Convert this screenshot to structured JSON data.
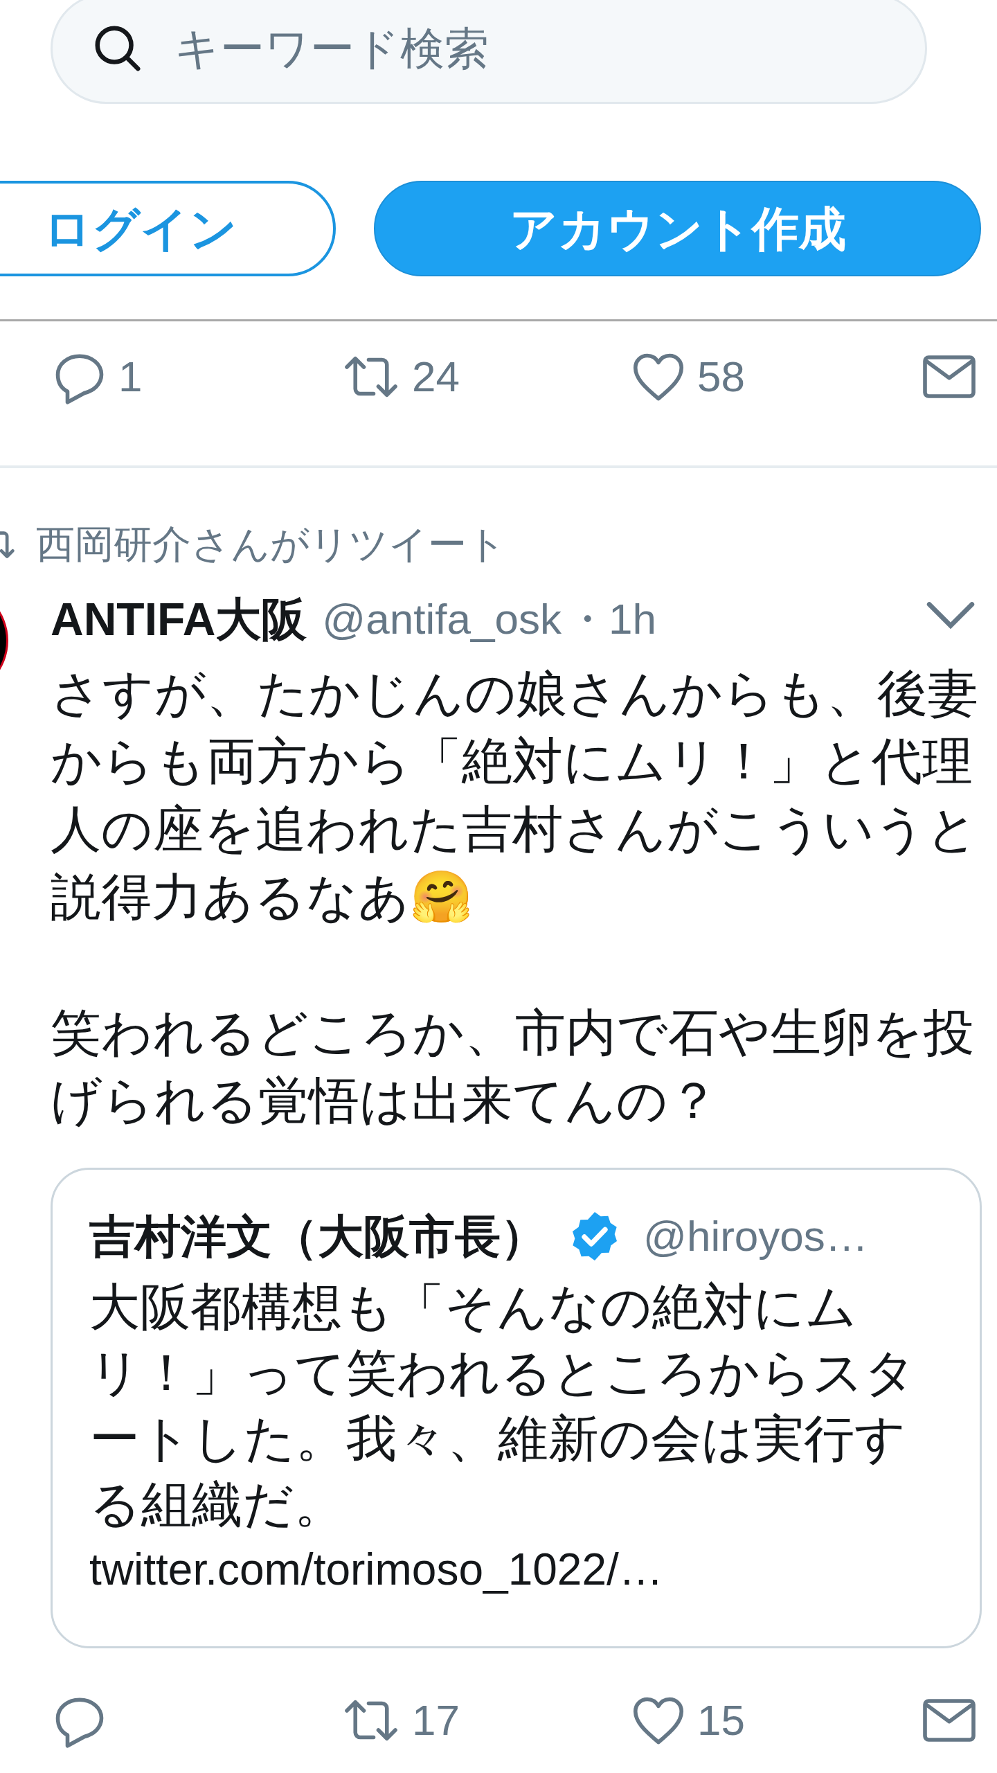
{
  "search": {
    "placeholder": "キーワード検索"
  },
  "auth_buttons": [
    {
      "label": "ログイン",
      "kind": "outline"
    },
    {
      "label": "アカウント作成",
      "kind": "filled"
    }
  ],
  "previous_tweet_actions": [
    {
      "kind": "reply",
      "count": "1"
    },
    {
      "kind": "retweet",
      "count": "24"
    },
    {
      "kind": "like",
      "count": "58"
    },
    {
      "kind": "message"
    }
  ],
  "tweet": {
    "retweeted_by": "西岡研介さんがリツイート",
    "author": "ANTIFA大阪",
    "handle": "@antifa_osk",
    "time": "・1h",
    "paragraphs": [
      {
        "text": "さすが、たかじんの娘さんからも、後妻からも両方から「絶対にムリ！」と代理人の座を追われた吉村さんがこういうと説得力あるなあ🤗"
      },
      {
        "text": "笑われるどころか、市内で石や生卵を投げられる覚悟は出来てんの？"
      }
    ],
    "quote": {
      "author": "吉村洋文（大阪市長）",
      "verified": true,
      "handle": "@hiroyos…",
      "text": "大阪都構想も「そんなの絶対にムリ！」って笑われるところからスタートした。我々、維新の会は実行する組織だ。",
      "link": "twitter.com/torimoso_1022/…"
    },
    "actions": [
      {
        "kind": "reply"
      },
      {
        "kind": "retweet",
        "count": "17"
      },
      {
        "kind": "like",
        "count": "15"
      },
      {
        "kind": "message"
      }
    ]
  }
}
